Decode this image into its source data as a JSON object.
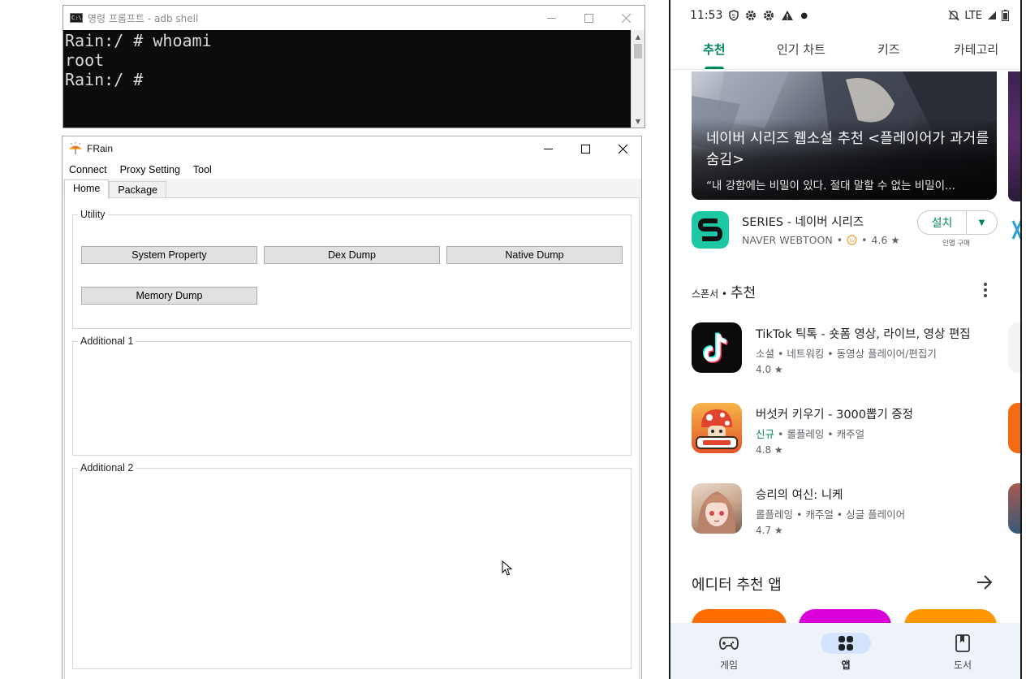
{
  "cmd": {
    "title": "명령 프롬프트 - adb  shell",
    "lines": [
      "Rain:/ # whoami",
      "root",
      "Rain:/ #"
    ]
  },
  "frain": {
    "title": "FRain",
    "menu": [
      "Connect",
      "Proxy Setting",
      "Tool"
    ],
    "tabs": [
      "Home",
      "Package"
    ],
    "groups": {
      "utility": "Utility",
      "additional1": "Additional 1",
      "additional2": "Additional 2"
    },
    "buttons": {
      "system_property": "System Property",
      "dex_dump": "Dex Dump",
      "native_dump": "Native Dump",
      "memory_dump": "Memory Dump"
    }
  },
  "android": {
    "status": {
      "time": "11:53",
      "network": "LTE"
    },
    "topnav": [
      "추천",
      "인기 차트",
      "키즈",
      "카테고리"
    ],
    "banner": {
      "title": "네이버 시리즈 웹소설 추천 <플레이어가 과거를 숨김>",
      "subtitle": "“내 강함에는 비밀이 있다. 절대 말할 수 없는 비밀이..."
    },
    "featured_app": {
      "name": "SERIES - 네이버 시리즈",
      "developer": "NAVER WEBTOON",
      "rating": "4.6 ★",
      "install_label": "설치",
      "inapp_label": "인앱 구매"
    },
    "sponsored": {
      "prefix": "스폰서 • ",
      "title": "추천"
    },
    "apps": [
      {
        "name": "TikTok 틱톡 - 숏폼 영상, 라이브, 영상 편집",
        "new": "",
        "category": "소셜 • 네트워킹 • 동영상 플레이어/편집기",
        "rating": "4.0 ★"
      },
      {
        "name": "버섯커 키우기 - 3000뽑기 증정",
        "new": "신규",
        "category": " • 롤플레잉 • 캐주얼",
        "rating": "4.8 ★"
      },
      {
        "name": "승리의 여신: 니케",
        "new": "",
        "category": "롤플레잉 • 캐주얼 • 싱글 플레이어",
        "rating": "4.7 ★"
      }
    ],
    "editor_section": "에디터 추천 앱",
    "bottomnav": [
      "게임",
      "앱",
      "도서"
    ],
    "colors": {
      "accent": "#01875f",
      "nav_active_bg": "#d3e3fd",
      "tiktok_bg": "#0b0b0b",
      "series_bg": "#1ec8a5"
    }
  }
}
